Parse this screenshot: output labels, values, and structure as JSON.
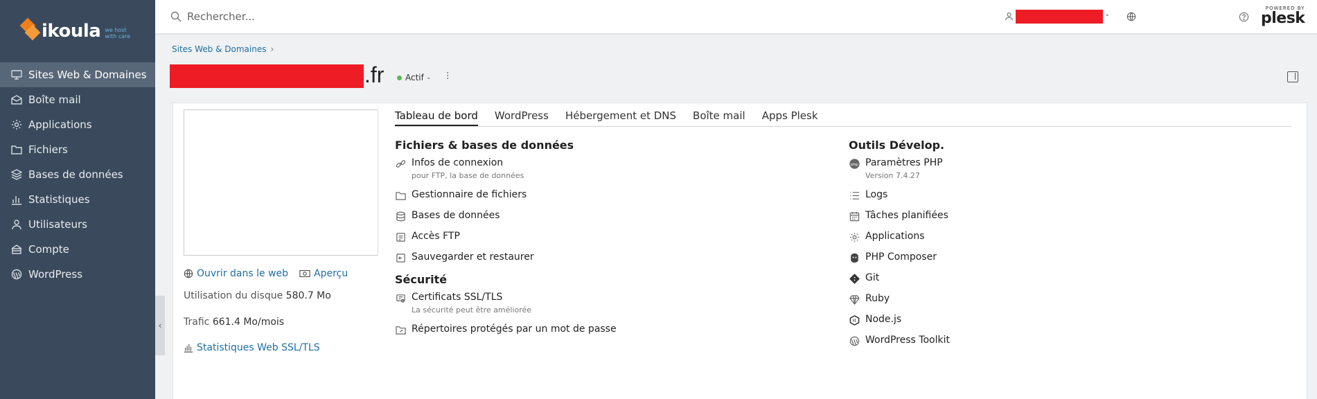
{
  "brand": {
    "name": "ikoula",
    "tagline_1": "we host",
    "tagline_2": "with care"
  },
  "sidebar": {
    "items": [
      {
        "label": "Sites Web & Domaines",
        "icon": "monitor-icon"
      },
      {
        "label": "Boîte mail",
        "icon": "mail-icon"
      },
      {
        "label": "Applications",
        "icon": "gear-icon"
      },
      {
        "label": "Fichiers",
        "icon": "folder-icon"
      },
      {
        "label": "Bases de données",
        "icon": "database-icon"
      },
      {
        "label": "Statistiques",
        "icon": "chart-icon"
      },
      {
        "label": "Utilisateurs",
        "icon": "user-icon"
      },
      {
        "label": "Compte",
        "icon": "account-icon"
      },
      {
        "label": "WordPress",
        "icon": "wordpress-icon"
      }
    ],
    "collapse_glyph": "‹"
  },
  "topbar": {
    "search_placeholder": "Rechercher...",
    "plesk_small": "POWERED BY",
    "plesk_big": "plesk"
  },
  "breadcrumb": {
    "item": "Sites Web & Domaines",
    "sep": "›"
  },
  "domain": {
    "suffix": ".fr",
    "status": "Actif"
  },
  "overview": {
    "open_web": "Ouvrir dans le web",
    "preview": "Aperçu",
    "disk_label": "Utilisation du disque",
    "disk_value": "580.7 Mo",
    "traffic_label": "Trafic",
    "traffic_value": "661.4 Mo/mois",
    "webstats": "Statistiques Web SSL/TLS"
  },
  "tabs": [
    "Tableau de bord",
    "WordPress",
    "Hébergement et DNS",
    "Boîte mail",
    "Apps Plesk"
  ],
  "files_section": {
    "title": "Fichiers & bases de données",
    "items": [
      {
        "label": "Infos de connexion",
        "sub": "pour FTP, la base de données"
      },
      {
        "label": "Gestionnaire de fichiers"
      },
      {
        "label": "Bases de données"
      },
      {
        "label": "Accès FTP"
      },
      {
        "label": "Sauvegarder et restaurer"
      }
    ]
  },
  "security_section": {
    "title": "Sécurité",
    "items": [
      {
        "label": "Certificats SSL/TLS",
        "sub": "La sécurité peut être améliorée"
      },
      {
        "label": "Répertoires protégés par un mot de passe"
      }
    ]
  },
  "dev_section": {
    "title": "Outils Dévelop.",
    "items": [
      {
        "label": "Paramètres PHP",
        "sub": "Version 7.4.27"
      },
      {
        "label": "Logs"
      },
      {
        "label": "Tâches planifiées"
      },
      {
        "label": "Applications"
      },
      {
        "label": "PHP Composer"
      },
      {
        "label": "Git"
      },
      {
        "label": "Ruby"
      },
      {
        "label": "Node.js"
      },
      {
        "label": "WordPress Toolkit"
      }
    ]
  }
}
